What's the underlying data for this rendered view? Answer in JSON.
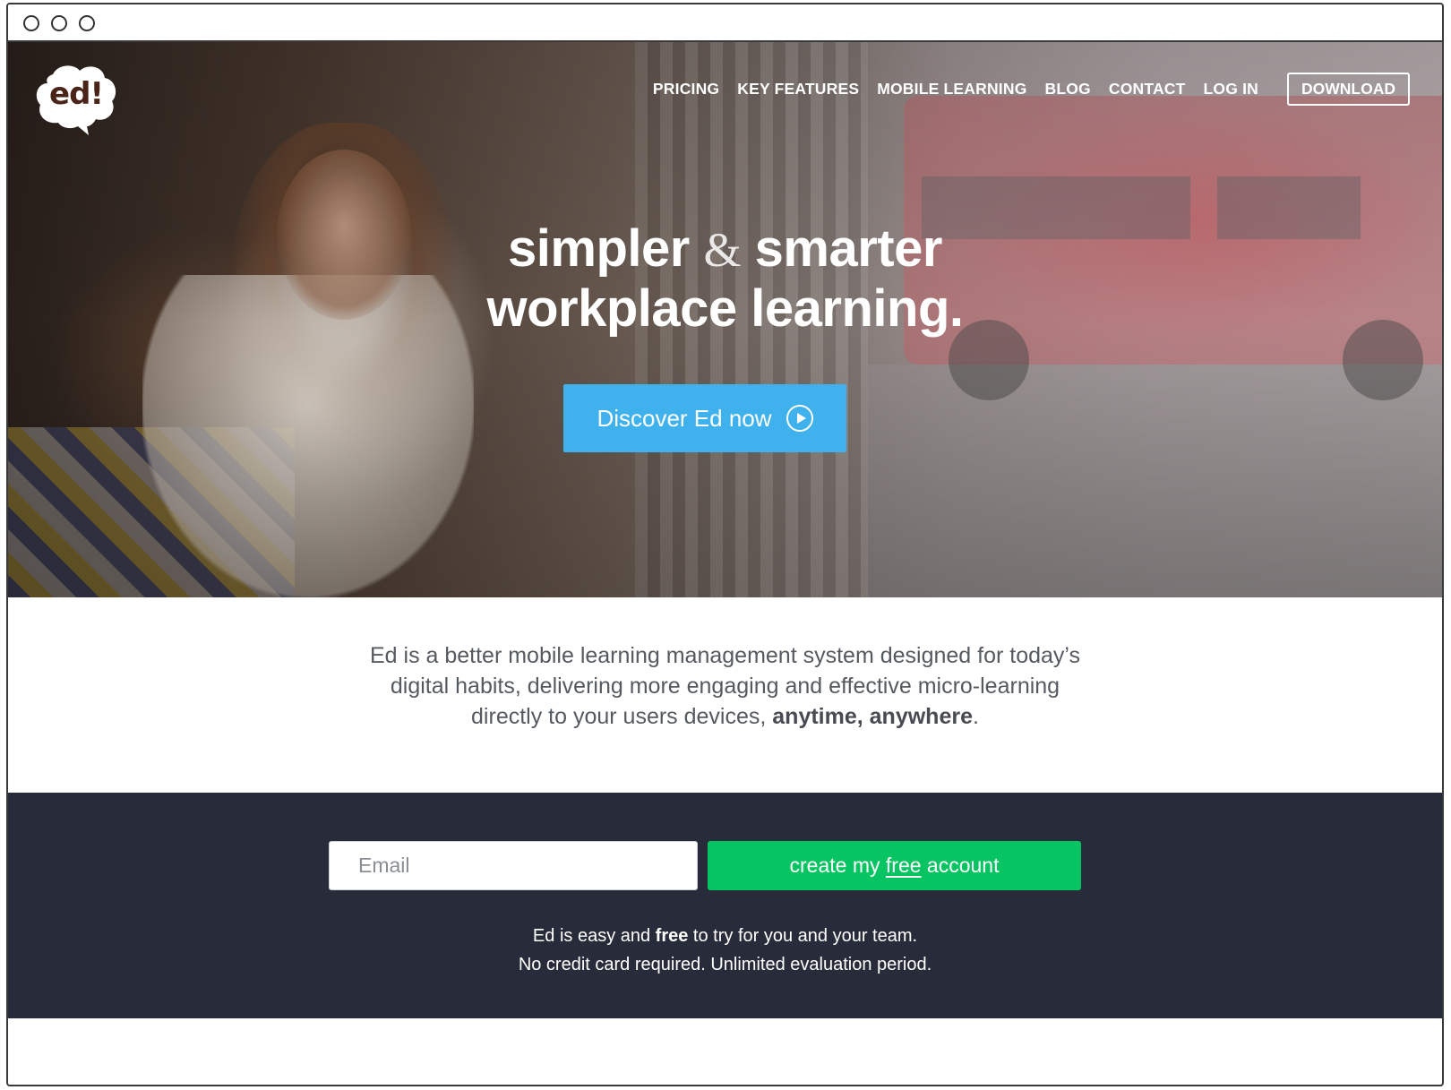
{
  "window": {
    "controls": [
      "close",
      "minimize",
      "maximize"
    ]
  },
  "logo": {
    "text": "ed!"
  },
  "nav": {
    "items": [
      {
        "label": "PRICING"
      },
      {
        "label": "KEY FEATURES"
      },
      {
        "label": "MOBILE LEARNING"
      },
      {
        "label": "BLOG"
      },
      {
        "label": "CONTACT"
      },
      {
        "label": "LOG IN"
      }
    ],
    "download_label": "DOWNLOAD"
  },
  "hero": {
    "headline_part1": "simpler",
    "headline_amp": "&",
    "headline_part2": "smarter",
    "headline_line2": "workplace learning.",
    "cta_label": "Discover Ed now",
    "cta_icon": "play-circle-icon"
  },
  "intro": {
    "line1": "Ed is a better mobile learning management system designed for today’s",
    "line2": "digital habits, delivering more engaging and effective micro-learning",
    "line3_prefix": "directly to your users devices, ",
    "line3_bold": "anytime, anywhere",
    "line3_suffix": "."
  },
  "signup": {
    "email_placeholder": "Email",
    "button_prefix": "create my ",
    "button_free": "free",
    "button_suffix": " account",
    "note_line1_prefix": "Ed is easy and ",
    "note_line1_bold": "free",
    "note_line1_suffix": " to try for you and your team.",
    "note_line2": "No credit card required. Unlimited evaluation period."
  },
  "colors": {
    "cta_blue": "#3fb1ec",
    "signup_green": "#06c462",
    "signup_bg": "#282c3a",
    "logo_brown": "#4a2418"
  }
}
